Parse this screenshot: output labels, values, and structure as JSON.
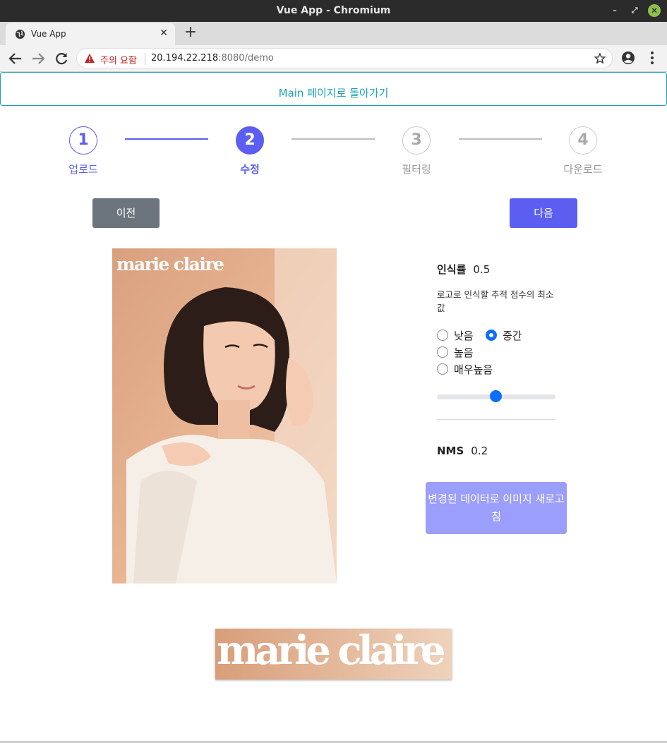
{
  "window": {
    "title": "Vue App - Chromium"
  },
  "tab": {
    "title": "Vue App"
  },
  "address_bar": {
    "warning": "주의 요함",
    "host": "20.194.22.218",
    "path": ":8080/demo"
  },
  "page": {
    "back_link": "Main 페이지로 돌아가기",
    "steps": [
      {
        "number": "1",
        "label": "업로드",
        "state": "done"
      },
      {
        "number": "2",
        "label": "수정",
        "state": "active"
      },
      {
        "number": "3",
        "label": "필터링",
        "state": "pending"
      },
      {
        "number": "4",
        "label": "다운로드",
        "state": "pending"
      }
    ],
    "prev_button": "이전",
    "next_button": "다음",
    "poster_brand": "marie claire",
    "recognition": {
      "label": "인식률",
      "value": "0.5",
      "description": "로고로 인식할 추적 점수의 최소값",
      "options": [
        "낮음",
        "중간",
        "높음",
        "매우높음"
      ],
      "selected": "중간",
      "slider_value": 0.5
    },
    "nms": {
      "label": "NMS",
      "value": "0.2"
    },
    "refresh_button": "변경된 데이터로 이미지 새로고침",
    "detected_logo": "marie claire"
  },
  "colors": {
    "accent": "#5b5ef0",
    "link": "#17a2b8",
    "secondary": "#6c757d",
    "radio": "#0d6efd",
    "refresh_button": "#9c9efb"
  }
}
